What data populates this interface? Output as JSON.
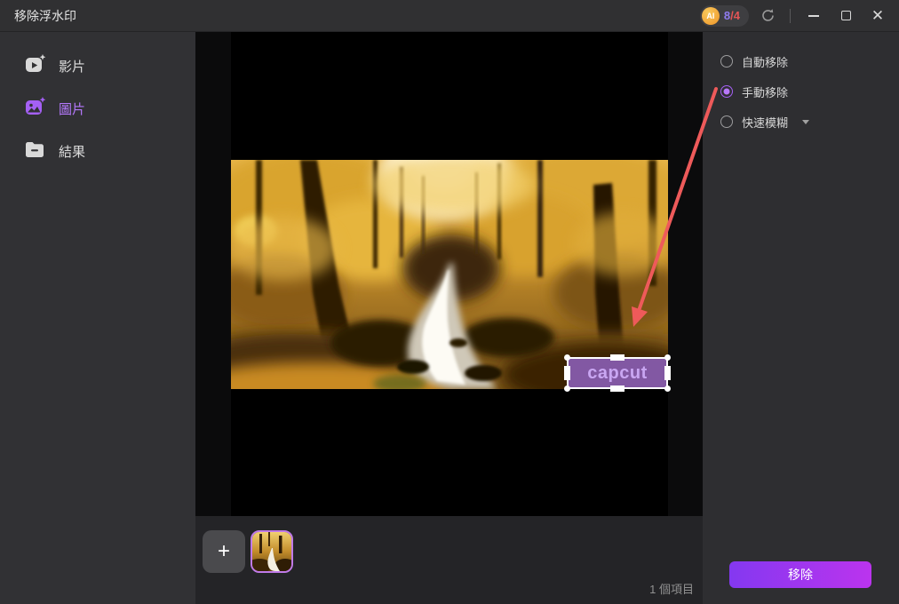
{
  "window": {
    "title": "移除浮水印"
  },
  "titlebar": {
    "ai_label": "AI",
    "credits_used": "8",
    "credits_total": "/4"
  },
  "sidebar": {
    "items": [
      {
        "label": "影片",
        "icon": "video-icon",
        "active": false
      },
      {
        "label": "圖片",
        "icon": "image-icon",
        "active": true
      },
      {
        "label": "結果",
        "icon": "folder-icon",
        "active": false
      }
    ]
  },
  "options": {
    "items": [
      {
        "label": "自動移除",
        "selected": false
      },
      {
        "label": "手動移除",
        "selected": true
      },
      {
        "label": "快速模糊",
        "selected": false,
        "has_dropdown": true
      }
    ]
  },
  "editor": {
    "watermark_text": "capcut"
  },
  "filmstrip": {
    "add_label": "+",
    "count_label": "1 個項目"
  },
  "actions": {
    "remove_label": "移除"
  },
  "colors": {
    "accent_purple": "#a560f5",
    "active_text": "#b478fa",
    "button_gradient_start": "#8438f0",
    "button_gradient_end": "#bb34ee",
    "arrow_red": "#ee5a5a",
    "watermark_fill": "#895db1",
    "watermark_text": "#c9a6f2",
    "ai_badge_orange": "#ee9428",
    "credits_used_color": "#8f7cf0",
    "credits_total_color": "#e25555",
    "thumb_border": "#c07ae8"
  }
}
